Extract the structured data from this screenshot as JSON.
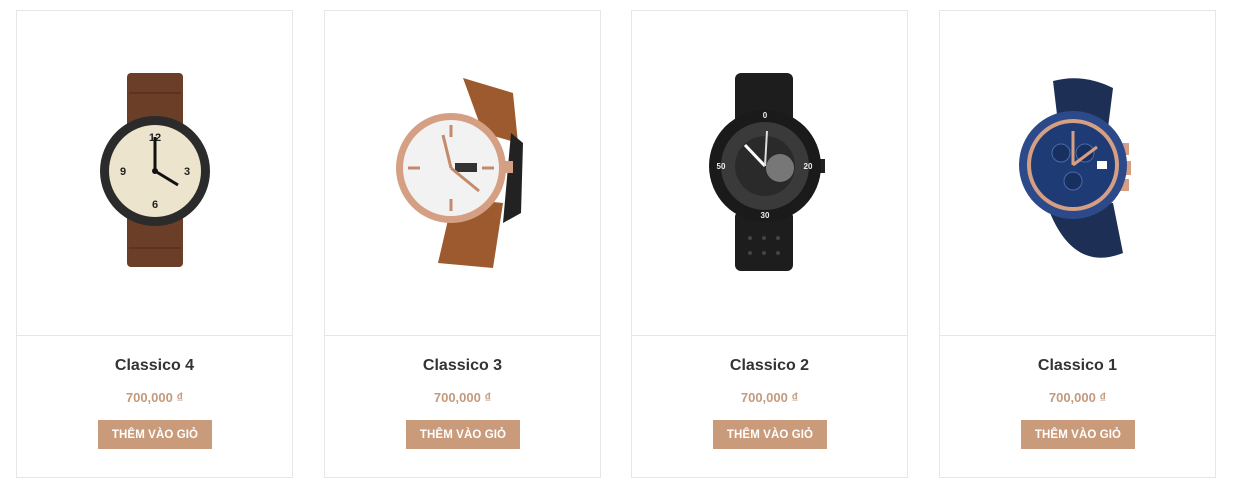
{
  "currency_color": "#c49a7c",
  "button_color": "#c99b7b",
  "products": [
    {
      "name": "Classico 4",
      "price": "700,000 ₫",
      "button": "THÊM VÀO GIỎ",
      "image": "brown-leather-field-watch"
    },
    {
      "name": "Classico 3",
      "price": "700,000 ₫",
      "button": "THÊM VÀO GIỎ",
      "image": "rose-gold-white-dial-watch"
    },
    {
      "name": "Classico 2",
      "price": "700,000 ₫",
      "button": "THÊM VÀO GIỎ",
      "image": "black-sport-dive-watch"
    },
    {
      "name": "Classico 1",
      "price": "700,000 ₫",
      "button": "THÊM VÀO GIỎ",
      "image": "blue-chronograph-watch"
    }
  ]
}
